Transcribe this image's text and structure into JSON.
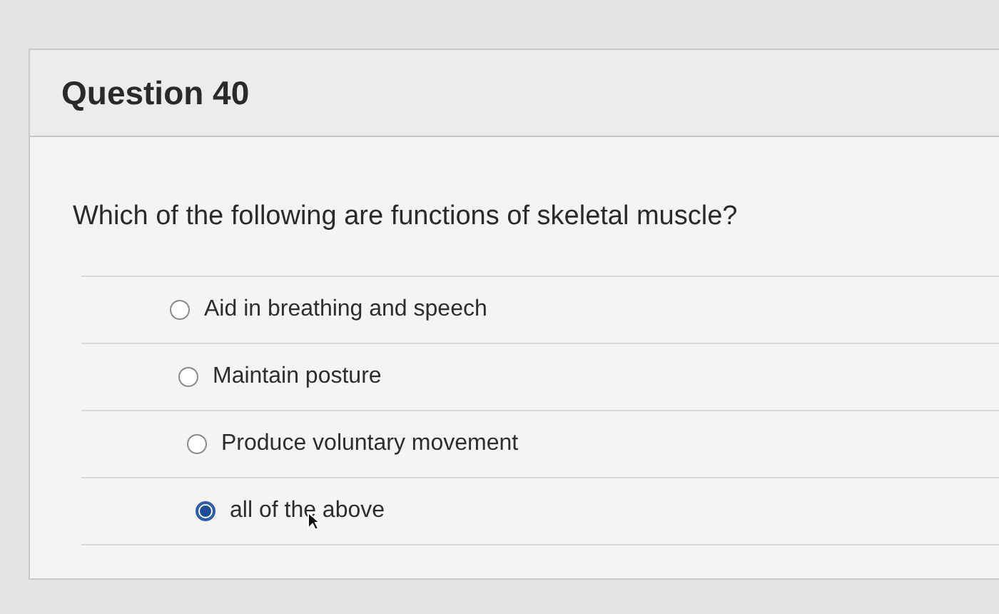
{
  "question": {
    "title": "Question 40",
    "prompt": "Which of the following are functions of skeletal muscle?",
    "options": [
      {
        "label": "Aid in breathing and speech",
        "selected": false
      },
      {
        "label": "Maintain posture",
        "selected": false
      },
      {
        "label": "Produce voluntary movement",
        "selected": false
      },
      {
        "label": "all of the above",
        "selected": true
      }
    ]
  }
}
